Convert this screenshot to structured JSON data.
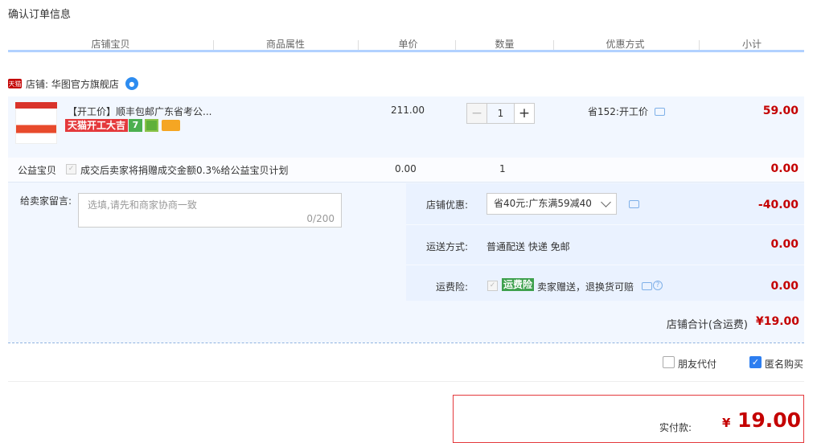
{
  "page_title": "确认订单信息",
  "columns": [
    "店铺宝贝",
    "商品属性",
    "单价",
    "数量",
    "优惠方式",
    "小计"
  ],
  "shop": {
    "badge": "天猫",
    "label": "店铺: 华图官方旗舰店"
  },
  "item": {
    "title": "【开工价】顺丰包邮广东省考公...",
    "promo_tag": "天猫开工大吉",
    "icon_7_text": "7",
    "price": "211.00",
    "quantity": "1",
    "discount": "省152:开工价",
    "subtotal": "59.00"
  },
  "charity": {
    "label": "公益宝贝",
    "text": "成交后卖家将捐赠成交金额0.3%给公益宝贝计划",
    "price": "0.00",
    "qty": "1",
    "subtotal": "0.00"
  },
  "message": {
    "label": "给卖家留言:",
    "placeholder": "选填,请先和商家协商一致",
    "count": "0/200"
  },
  "shop_discount": {
    "label": "店铺优惠:",
    "selected": "省40元:广东满59减40",
    "amount": "-40.00"
  },
  "shipping": {
    "label": "运送方式:",
    "value": "普通配送 快递 免邮",
    "amount": "0.00"
  },
  "freight_insurance": {
    "label": "运费险:",
    "tag": "运费险",
    "text": "卖家赠送，退换货可赔",
    "amount": "0.00"
  },
  "shop_total": {
    "label": "店铺合计(含运费)",
    "value": "¥19.00"
  },
  "options": {
    "friend_pay": "朋友代付",
    "anonymous": "匿名购买"
  },
  "payment": {
    "label": "实付款:",
    "yen": "¥",
    "value": "19.00"
  },
  "colors": {
    "price_red": "#c40000",
    "header_line": "#b2d1ff",
    "row_bg": "#f2f7ff"
  }
}
